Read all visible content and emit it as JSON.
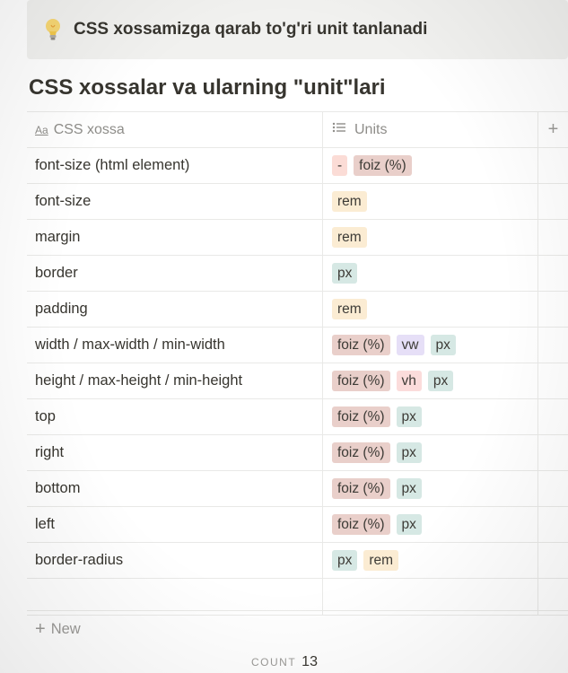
{
  "callout": {
    "icon": "lightbulb-icon",
    "text": "CSS xossamizga qarab to'g'ri unit tanlanadi"
  },
  "database": {
    "title": "CSS xossalar va ularning \"unit\"lari",
    "columns": [
      {
        "icon": "Aa",
        "label": "CSS xossa"
      },
      {
        "icon": "list-icon",
        "label": "Units"
      }
    ],
    "rows": [
      {
        "name": "font-size (html element)",
        "units": [
          "-",
          "foiz (%)"
        ]
      },
      {
        "name": "font-size",
        "units": [
          "rem"
        ]
      },
      {
        "name": "margin",
        "units": [
          "rem"
        ]
      },
      {
        "name": "border",
        "units": [
          "px"
        ]
      },
      {
        "name": "padding",
        "units": [
          "rem"
        ]
      },
      {
        "name": "width / max-width / min-width",
        "units": [
          "foiz (%)",
          "vw",
          "px"
        ]
      },
      {
        "name": "height / max-height / min-height",
        "units": [
          "foiz (%)",
          "vh",
          "px"
        ]
      },
      {
        "name": "top",
        "units": [
          "foiz (%)",
          "px"
        ]
      },
      {
        "name": "right",
        "units": [
          "foiz (%)",
          "px"
        ]
      },
      {
        "name": "bottom",
        "units": [
          "foiz (%)",
          "px"
        ]
      },
      {
        "name": "left",
        "units": [
          "foiz (%)",
          "px"
        ]
      },
      {
        "name": "border-radius",
        "units": [
          "px",
          "rem"
        ]
      }
    ],
    "new_label": "New",
    "count_label": "COUNT",
    "count_value": "13"
  },
  "tag_colors": {
    "-": "#fbdcd6",
    "foiz (%)": "#e9cfca",
    "rem": "#fbecd3",
    "px": "#d6e8e4",
    "vw": "#e6dff7",
    "vh": "#fbdcdb"
  }
}
